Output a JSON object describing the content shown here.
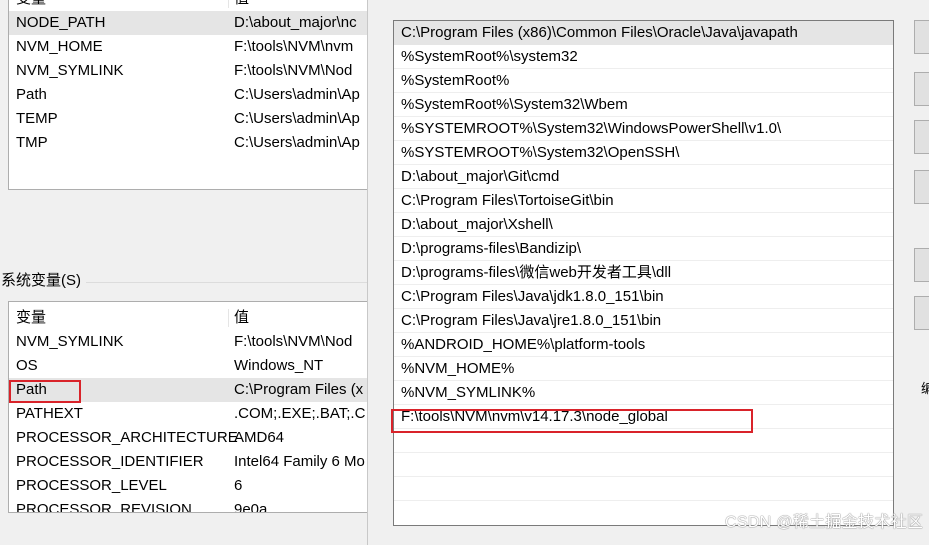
{
  "user_variables": {
    "header": {
      "name": "变量",
      "value": "值"
    },
    "rows": [
      {
        "name": "NODE_PATH",
        "value": "D:\\about_major\\nc"
      },
      {
        "name": "NVM_HOME",
        "value": "F:\\tools\\NVM\\nvm"
      },
      {
        "name": "NVM_SYMLINK",
        "value": "F:\\tools\\NVM\\Nod"
      },
      {
        "name": "Path",
        "value": "C:\\Users\\admin\\Ap"
      },
      {
        "name": "TEMP",
        "value": "C:\\Users\\admin\\Ap"
      },
      {
        "name": "TMP",
        "value": "C:\\Users\\admin\\Ap"
      }
    ]
  },
  "system_variables": {
    "section_label": "系统变量(S)",
    "header": {
      "name": "变量",
      "value": "值"
    },
    "rows": [
      {
        "name": "NVM_SYMLINK",
        "value": "F:\\tools\\NVM\\Nod"
      },
      {
        "name": "OS",
        "value": "Windows_NT"
      },
      {
        "name": "Path",
        "value": "C:\\Program Files (x"
      },
      {
        "name": "PATHEXT",
        "value": ".COM;.EXE;.BAT;.C"
      },
      {
        "name": "PROCESSOR_ARCHITECTURE",
        "value": "AMD64"
      },
      {
        "name": "PROCESSOR_IDENTIFIER",
        "value": "Intel64 Family 6 Mo"
      },
      {
        "name": "PROCESSOR_LEVEL",
        "value": "6"
      },
      {
        "name": "PROCESSOR_REVISION",
        "value": "9e0a"
      }
    ]
  },
  "edit_path": {
    "entries": [
      "C:\\Program Files (x86)\\Common Files\\Oracle\\Java\\javapath",
      "%SystemRoot%\\system32",
      "%SystemRoot%",
      "%SystemRoot%\\System32\\Wbem",
      "%SYSTEMROOT%\\System32\\WindowsPowerShell\\v1.0\\",
      "%SYSTEMROOT%\\System32\\OpenSSH\\",
      "D:\\about_major\\Git\\cmd",
      "C:\\Program Files\\TortoiseGit\\bin",
      "D:\\about_major\\Xshell\\",
      "D:\\programs-files\\Bandizip\\",
      "D:\\programs-files\\微信web开发者工具\\dll",
      "C:\\Program Files\\Java\\jdk1.8.0_151\\bin",
      "C:\\Program Files\\Java\\jre1.8.0_151\\bin",
      "%ANDROID_HOME%\\platform-tools",
      "%NVM_HOME%",
      "%NVM_SYMLINK%",
      "F:\\tools\\NVM\\nvm\\v14.17.3\\node_global"
    ],
    "clipped_button_char": "编"
  },
  "colors": {
    "highlight": "#d9232a",
    "selection": "#e5e5e5"
  },
  "watermark": "CSDN @稀土掘金技术社区"
}
